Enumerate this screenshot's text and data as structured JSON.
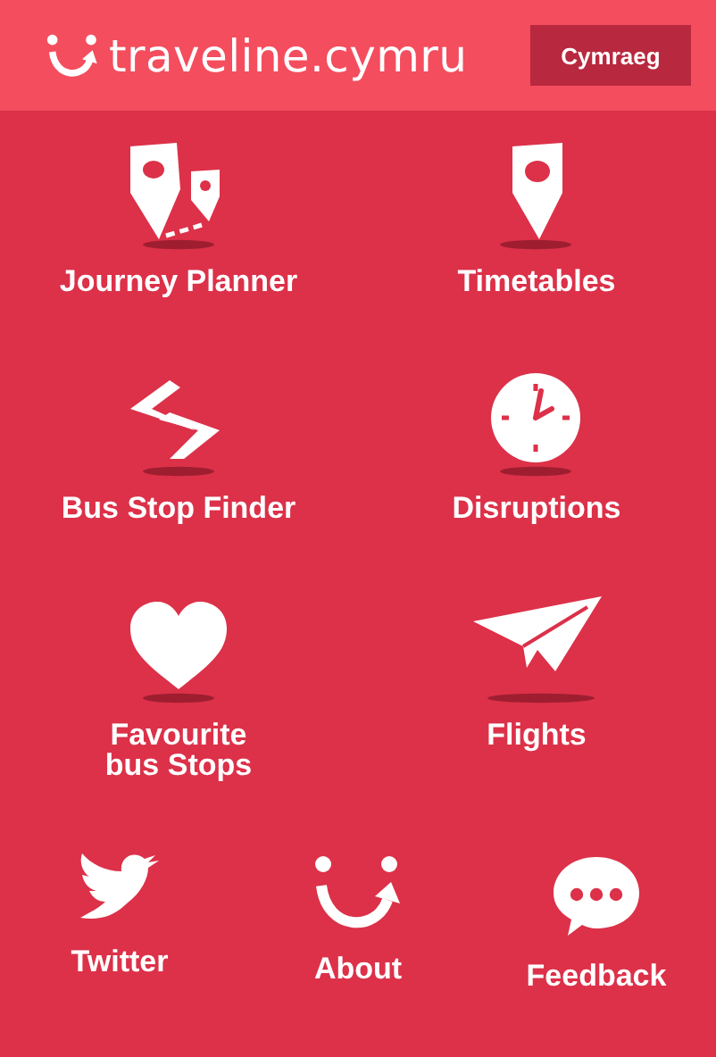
{
  "header": {
    "logo_text": "traveline.cymru",
    "language_button": "Cymraeg"
  },
  "menu": [
    {
      "kind": "journey",
      "label": "Journey Planner"
    },
    {
      "kind": "timetable",
      "label": "Timetables"
    },
    {
      "kind": "stops",
      "label": "Bus Stop Finder"
    },
    {
      "kind": "disruptions",
      "label": "Disruptions"
    },
    {
      "kind": "favourites",
      "label": "Favourite\nbus Stops"
    },
    {
      "kind": "flights",
      "label": "Flights"
    }
  ],
  "footer_menu": [
    {
      "kind": "twitter",
      "label": "Twitter"
    },
    {
      "kind": "about",
      "label": "About"
    },
    {
      "kind": "feedback",
      "label": "Feedback"
    }
  ]
}
